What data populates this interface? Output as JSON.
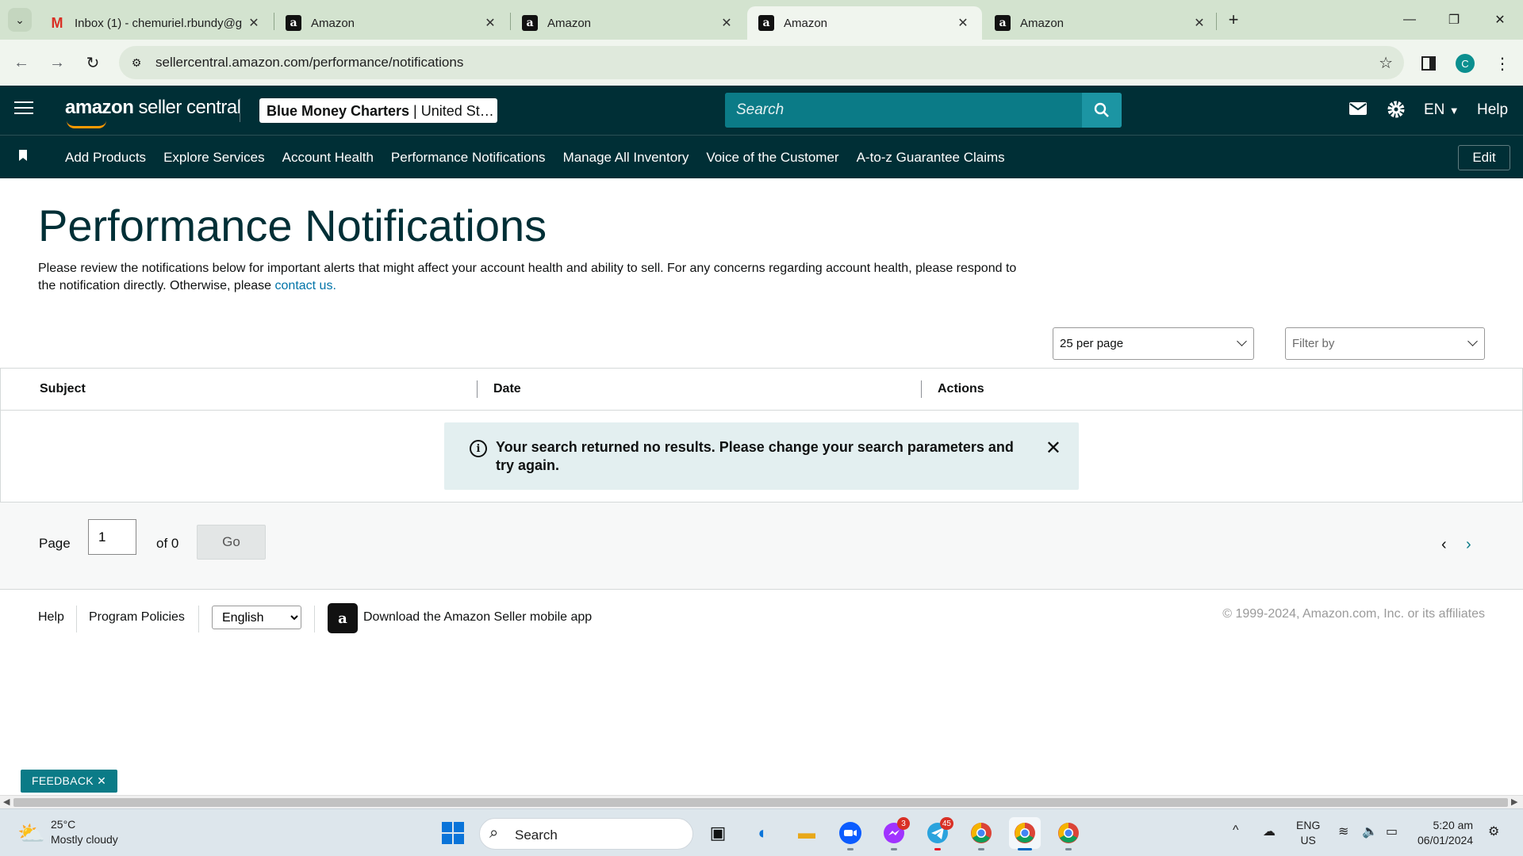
{
  "browser": {
    "tabs": [
      {
        "title": "Inbox (1) - chemuriel.rbundy@g",
        "favicon": "gmail-icon"
      },
      {
        "title": "Amazon",
        "favicon": "amazon-icon"
      },
      {
        "title": "Amazon",
        "favicon": "amazon-icon"
      },
      {
        "title": "Amazon",
        "favicon": "amazon-icon",
        "active": true
      },
      {
        "title": "Amazon",
        "favicon": "amazon-icon"
      }
    ],
    "url": "sellercentral.amazon.com/performance/notifications",
    "profile_initial": "C"
  },
  "header": {
    "logo_brand": "amazon",
    "logo_product": "seller central",
    "store_name": "Blue Money Charters",
    "store_region": "United St…",
    "search_placeholder": "Search",
    "language": "EN",
    "help": "Help"
  },
  "nav": {
    "items": [
      "Add Products",
      "Explore Services",
      "Account Health",
      "Performance Notifications",
      "Manage All Inventory",
      "Voice of the Customer",
      "A-to-z Guarantee Claims"
    ],
    "edit_label": "Edit"
  },
  "main": {
    "title": "Performance Notifications",
    "intro": "Please review the notifications below for important alerts that might affect your account health and ability to sell. For any concerns regarding account health, please respond to the notification directly. Otherwise, please ",
    "contact_link": "contact us.",
    "per_page": "25 per page",
    "filter_placeholder": "Filter by",
    "columns": [
      "Subject",
      "Date",
      "Actions"
    ],
    "alert": "Your search returned no results. Please change your search parameters and try again.",
    "pagination": {
      "page_label": "Page",
      "current_page": "1",
      "of_label": "of 0",
      "go_label": "Go"
    }
  },
  "footer": {
    "help": "Help",
    "program_policies": "Program Policies",
    "language_selected": "English",
    "app_link": "Download the Amazon Seller mobile app",
    "copyright": "© 1999-2024, Amazon.com, Inc. or its affiliates"
  },
  "feedback_label": "FEEDBACK",
  "taskbar": {
    "weather_temp": "25°C",
    "weather_desc": "Mostly cloudy",
    "search_label": "Search",
    "messenger_badge": "3",
    "telegram_badge": "45",
    "lang_line1": "ENG",
    "lang_line2": "US",
    "time": "5:20 am",
    "date": "06/01/2024"
  },
  "colors": {
    "header_bg": "#002f36",
    "search_bg": "#0b7b87",
    "title_color": "#002f36",
    "link": "#0073a8",
    "alert_bg": "#e3eff0",
    "tabbar_bg": "#d3e3cf"
  }
}
